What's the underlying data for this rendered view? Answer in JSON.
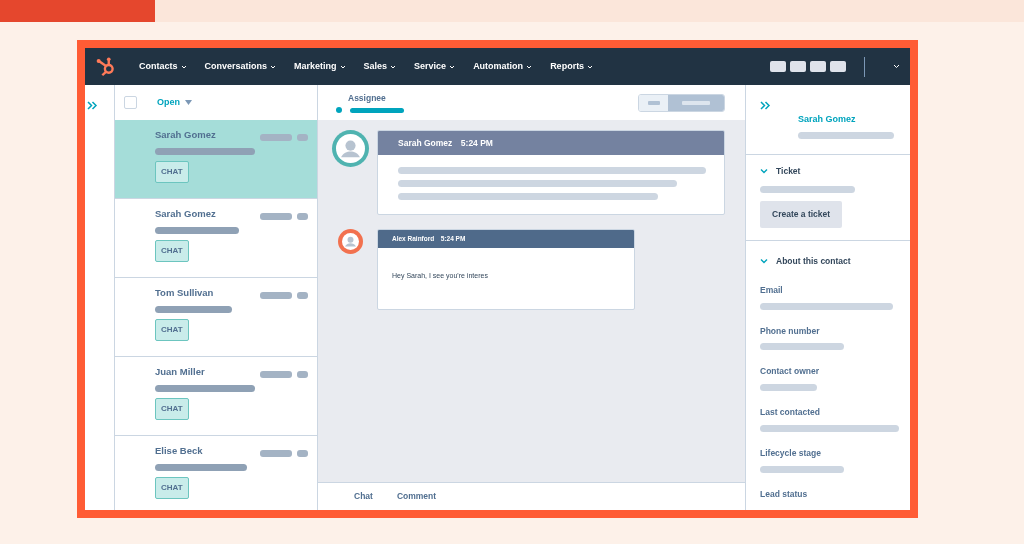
{
  "navbar": {
    "items": [
      "Contacts",
      "Conversations",
      "Marketing",
      "Sales",
      "Service",
      "Automation",
      "Reports"
    ]
  },
  "inbox": {
    "select_all_checked": false,
    "filter": "Open",
    "conversations": [
      {
        "name": "Sarah Gomez",
        "tag": "CHAT",
        "selected": true
      },
      {
        "name": "Sarah Gomez",
        "tag": "CHAT",
        "selected": false
      },
      {
        "name": "Tom Sullivan",
        "tag": "CHAT",
        "selected": false
      },
      {
        "name": "Juan Miller",
        "tag": "CHAT",
        "selected": false
      },
      {
        "name": "Elise Beck",
        "tag": "CHAT",
        "selected": false
      }
    ]
  },
  "thread": {
    "assignee_label": "Assignee",
    "view_toggle": [
      {
        "selected": false
      },
      {
        "selected": true
      }
    ],
    "messages": [
      {
        "kind": "customer",
        "author": "Sarah Gomez",
        "time": "5:24 PM"
      },
      {
        "kind": "agent",
        "author": "Alex Rainford",
        "time": "5:24 PM",
        "text": "Hey Sarah, I see you're interes"
      }
    ],
    "composer_tabs": [
      "Chat",
      "Comment"
    ]
  },
  "contact_panel": {
    "name": "Sarah Gomez",
    "sections": [
      {
        "title": "Ticket",
        "expanded": true,
        "button": "Create a ticket"
      },
      {
        "title": "About this contact",
        "expanded": true,
        "fields": [
          "Email",
          "Phone number",
          "Contact owner",
          "Last contacted",
          "Lifecycle stage",
          "Lead status"
        ]
      }
    ]
  }
}
